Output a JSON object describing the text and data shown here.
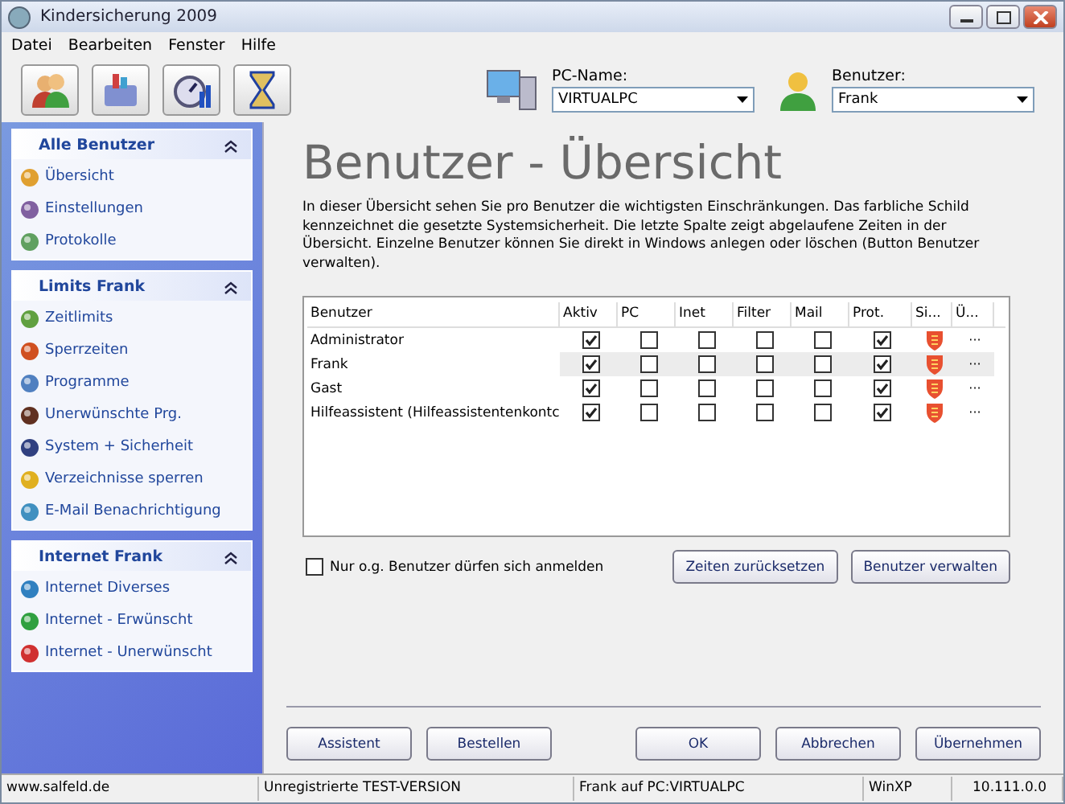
{
  "window": {
    "title": "Kindersicherung 2009"
  },
  "menu": [
    "Datei",
    "Bearbeiten",
    "Fenster",
    "Hilfe"
  ],
  "pc_name": {
    "label": "PC-Name:",
    "value": "VIRTUALPC"
  },
  "user": {
    "label": "Benutzer:",
    "value": "Frank"
  },
  "sidebar": [
    {
      "title": "Alle Benutzer",
      "expanded": true,
      "items": [
        "Übersicht",
        "Einstellungen",
        "Protokolle"
      ]
    },
    {
      "title": "Limits Frank",
      "expanded": true,
      "items": [
        "Zeitlimits",
        "Sperrzeiten",
        "Programme",
        "Unerwünschte Prg.",
        "System + Sicherheit",
        "Verzeichnisse sperren",
        "E-Mail Benachrichtigung"
      ]
    },
    {
      "title": "Internet Frank",
      "expanded": true,
      "items": [
        "Internet Diverses",
        "Internet - Erwünscht",
        "Internet - Unerwünscht"
      ]
    }
  ],
  "heading": "Benutzer - Übersicht",
  "description": "In dieser Übersicht sehen Sie pro Benutzer die wichtigsten Einschränkungen. Das farbliche Schild kennzeichnet die gesetzte Systemsicherheit. Die letzte Spalte zeigt abgelaufene Zeiten in der Übersicht. Einzelne Benutzer können Sie direkt in Windows anlegen oder löschen (Button Benutzer verwalten).",
  "table": {
    "columns": [
      "Benutzer",
      "Aktiv",
      "PC",
      "Inet",
      "Filter",
      "Mail",
      "Prot.",
      "Si...",
      "Ü..."
    ],
    "rows": [
      {
        "name": "Administrator",
        "selected": false,
        "checks": [
          true,
          false,
          false,
          false,
          false,
          true
        ],
        "more": "···"
      },
      {
        "name": "Frank",
        "selected": true,
        "checks": [
          true,
          false,
          false,
          false,
          false,
          true
        ],
        "more": "···"
      },
      {
        "name": "Gast",
        "selected": false,
        "checks": [
          true,
          false,
          false,
          false,
          false,
          true
        ],
        "more": "···"
      },
      {
        "name": "Hilfeassistent (Hilfeassistentenkontc",
        "selected": false,
        "checks": [
          true,
          false,
          false,
          false,
          false,
          true
        ],
        "more": "···"
      }
    ]
  },
  "only_listed": {
    "label": "Nur o.g. Benutzer dürfen sich anmelden",
    "checked": false
  },
  "table_buttons": [
    "Zeiten zurücksetzen",
    "Benutzer verwalten"
  ],
  "left_buttons": [
    "Assistent",
    "Bestellen"
  ],
  "right_buttons": [
    "OK",
    "Abbrechen",
    "Übernehmen"
  ],
  "status_bar": [
    "www.salfeld.de",
    "Unregistrierte TEST-VERSION",
    "Frank auf PC:VIRTUALPC",
    "WinXP",
    "10.111.0.0"
  ]
}
